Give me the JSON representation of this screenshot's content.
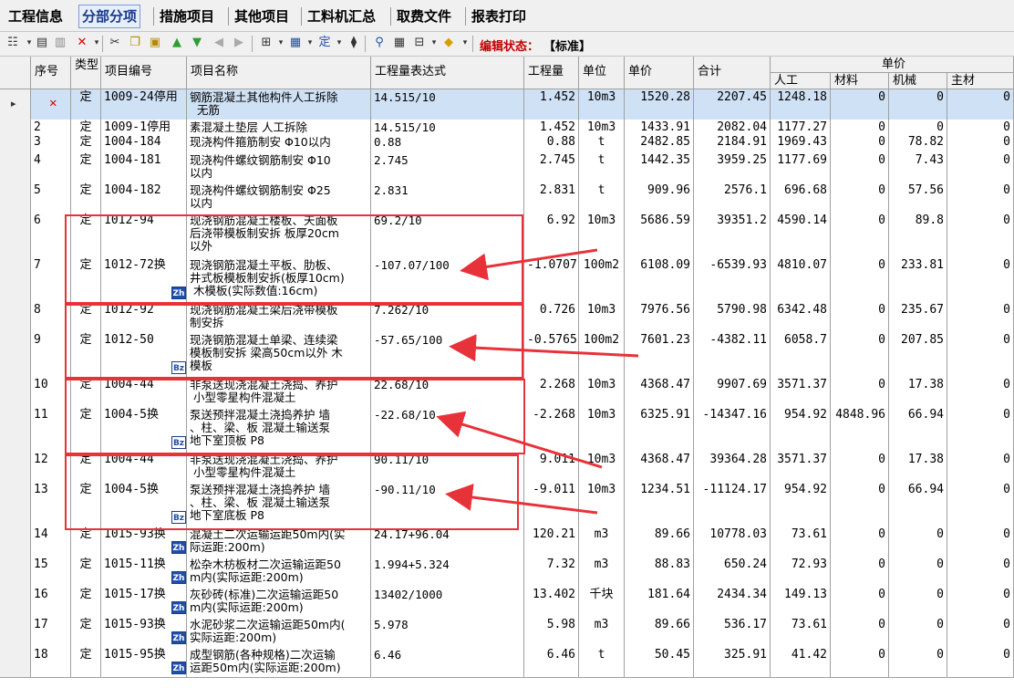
{
  "menu": [
    "工程信息",
    "分部分项",
    "措施项目",
    "其他项目",
    "工料机汇总",
    "取费文件",
    "报表打印"
  ],
  "active_menu_index": 1,
  "toolbar": {
    "status_label": "编辑状态：",
    "status_value": "【标准】"
  },
  "columns": {
    "seq": "序号",
    "type": "类型",
    "code": "项目编号",
    "name": "项目名称",
    "expr": "工程量表达式",
    "qty": "工程量",
    "unit": "单位",
    "price": "单价",
    "total": "合计",
    "unit_price_group": "单价",
    "labor": "人工",
    "material": "材料",
    "machine": "机械",
    "main_material": "主材"
  },
  "rows": [
    {
      "seq": "",
      "type": "定",
      "code": "1009-24停用",
      "name": "钢筋混凝土其他构件人工拆除\n  无筋",
      "expr": "14.515/10",
      "qty": "1.452",
      "unit": "10m3",
      "price": "1520.28",
      "total": "2207.45",
      "labor": "1248.18",
      "material": "0",
      "machine": "0",
      "main": "0",
      "badge": "",
      "selected": true
    },
    {
      "seq": "2",
      "type": "定",
      "code": "1009-1停用",
      "name": "素混凝土垫层 人工拆除",
      "expr": "14.515/10",
      "qty": "1.452",
      "unit": "10m3",
      "price": "1433.91",
      "total": "2082.04",
      "labor": "1177.27",
      "material": "0",
      "machine": "0",
      "main": "0",
      "badge": ""
    },
    {
      "seq": "3",
      "type": "定",
      "code": "1004-184",
      "name": "现浇构件箍筋制安 Φ10以内",
      "expr": "0.88",
      "qty": "0.88",
      "unit": "t",
      "price": "2482.85",
      "total": "2184.91",
      "labor": "1969.43",
      "material": "0",
      "machine": "78.82",
      "main": "0",
      "badge": ""
    },
    {
      "seq": "4",
      "type": "定",
      "code": "1004-181",
      "name": "现浇构件螺纹钢筋制安 Φ10\n以内",
      "expr": "2.745",
      "qty": "2.745",
      "unit": "t",
      "price": "1442.35",
      "total": "3959.25",
      "labor": "1177.69",
      "material": "0",
      "machine": "7.43",
      "main": "0",
      "badge": ""
    },
    {
      "seq": "5",
      "type": "定",
      "code": "1004-182",
      "name": "现浇构件螺纹钢筋制安 Φ25\n以内",
      "expr": "2.831",
      "qty": "2.831",
      "unit": "t",
      "price": "909.96",
      "total": "2576.1",
      "labor": "696.68",
      "material": "0",
      "machine": "57.56",
      "main": "0",
      "badge": ""
    },
    {
      "seq": "6",
      "type": "定",
      "code": "1012-94",
      "name": "现浇钢筋混凝土楼板、天面板\n后浇带模板制安拆 板厚20cm\n以外",
      "expr": "69.2/10",
      "qty": "6.92",
      "unit": "10m3",
      "price": "5686.59",
      "total": "39351.2",
      "labor": "4590.14",
      "material": "0",
      "machine": "89.8",
      "main": "0",
      "badge": ""
    },
    {
      "seq": "7",
      "type": "定",
      "code": "1012-72换",
      "name": "现浇钢筋混凝土平板、肋板、\n井式板模板制安拆(板厚10cm)\n 木模板(实际数值:16cm)",
      "expr": "-107.07/100",
      "qty": "-1.0707",
      "unit": "100m2",
      "price": "6108.09",
      "total": "-6539.93",
      "labor": "4810.07",
      "material": "0",
      "machine": "233.81",
      "main": "0",
      "badge": "zh"
    },
    {
      "seq": "8",
      "type": "定",
      "code": "1012-92",
      "name": "现浇钢筋混凝土梁后浇带模板\n制安拆",
      "expr": "7.262/10",
      "qty": "0.726",
      "unit": "10m3",
      "price": "7976.56",
      "total": "5790.98",
      "labor": "6342.48",
      "material": "0",
      "machine": "235.67",
      "main": "0",
      "badge": ""
    },
    {
      "seq": "9",
      "type": "定",
      "code": "1012-50",
      "name": "现浇钢筋混凝土单梁、连续梁\n模板制安拆 梁高50cm以外 木\n模板",
      "expr": "-57.65/100",
      "qty": "-0.5765",
      "unit": "100m2",
      "price": "7601.23",
      "total": "-4382.11",
      "labor": "6058.7",
      "material": "0",
      "machine": "207.85",
      "main": "0",
      "badge": "bz"
    },
    {
      "seq": "10",
      "type": "定",
      "code": "1004-44",
      "name": "非泵送现浇混凝土浇捣、养护\n 小型零星构件混凝土",
      "expr": "22.68/10",
      "qty": "2.268",
      "unit": "10m3",
      "price": "4368.47",
      "total": "9907.69",
      "labor": "3571.37",
      "material": "0",
      "machine": "17.38",
      "main": "0",
      "badge": ""
    },
    {
      "seq": "11",
      "type": "定",
      "code": "1004-5换",
      "name": "泵送预拌混凝土浇捣养护 墙\n、柱、梁、板 混凝土输送泵\n地下室顶板 P8",
      "expr": "-22.68/10",
      "qty": "-2.268",
      "unit": "10m3",
      "price": "6325.91",
      "total": "-14347.16",
      "labor": "954.92",
      "material": "4848.96",
      "machine": "66.94",
      "main": "0",
      "badge": "bz"
    },
    {
      "seq": "12",
      "type": "定",
      "code": "1004-44",
      "name": "非泵送现浇混凝土浇捣、养护\n 小型零星构件混凝土",
      "expr": "90.11/10",
      "qty": "9.011",
      "unit": "10m3",
      "price": "4368.47",
      "total": "39364.28",
      "labor": "3571.37",
      "material": "0",
      "machine": "17.38",
      "main": "0",
      "badge": ""
    },
    {
      "seq": "13",
      "type": "定",
      "code": "1004-5换",
      "name": "泵送预拌混凝土浇捣养护 墙\n、柱、梁、板 混凝土输送泵\n地下室底板 P8",
      "expr": "-90.11/10",
      "qty": "-9.011",
      "unit": "10m3",
      "price": "1234.51",
      "total": "-11124.17",
      "labor": "954.92",
      "material": "0",
      "machine": "66.94",
      "main": "0",
      "badge": "bz"
    },
    {
      "seq": "14",
      "type": "定",
      "code": "1015-93换",
      "name": "混凝土二次运输运距50m内(实\n际运距:200m)",
      "expr": "24.17+96.04",
      "qty": "120.21",
      "unit": "m3",
      "price": "89.66",
      "total": "10778.03",
      "labor": "73.61",
      "material": "0",
      "machine": "0",
      "main": "0",
      "badge": "zh"
    },
    {
      "seq": "15",
      "type": "定",
      "code": "1015-11换",
      "name": "松杂木枋板材二次运输运距50\nm内(实际运距:200m)",
      "expr": "1.994+5.324",
      "qty": "7.32",
      "unit": "m3",
      "price": "88.83",
      "total": "650.24",
      "labor": "72.93",
      "material": "0",
      "machine": "0",
      "main": "0",
      "badge": "zh"
    },
    {
      "seq": "16",
      "type": "定",
      "code": "1015-17换",
      "name": "灰砂砖(标准)二次运输运距50\nm内(实际运距:200m)",
      "expr": "13402/1000",
      "qty": "13.402",
      "unit": "千块",
      "price": "181.64",
      "total": "2434.34",
      "labor": "149.13",
      "material": "0",
      "machine": "0",
      "main": "0",
      "badge": "zh"
    },
    {
      "seq": "17",
      "type": "定",
      "code": "1015-93换",
      "name": "水泥砂浆二次运输运距50m内(\n实际运距:200m)",
      "expr": "5.978",
      "qty": "5.98",
      "unit": "m3",
      "price": "89.66",
      "total": "536.17",
      "labor": "73.61",
      "material": "0",
      "machine": "0",
      "main": "0",
      "badge": "zh"
    },
    {
      "seq": "18",
      "type": "定",
      "code": "1015-95换",
      "name": "成型钢筋(各种规格)二次运输\n运距50m内(实际运距:200m)",
      "expr": "6.46",
      "qty": "6.46",
      "unit": "t",
      "price": "50.45",
      "total": "325.91",
      "labor": "41.42",
      "material": "0",
      "machine": "0",
      "main": "0",
      "badge": "zh"
    }
  ],
  "badge_text": {
    "zh": "Zh",
    "bz": "Bz"
  }
}
